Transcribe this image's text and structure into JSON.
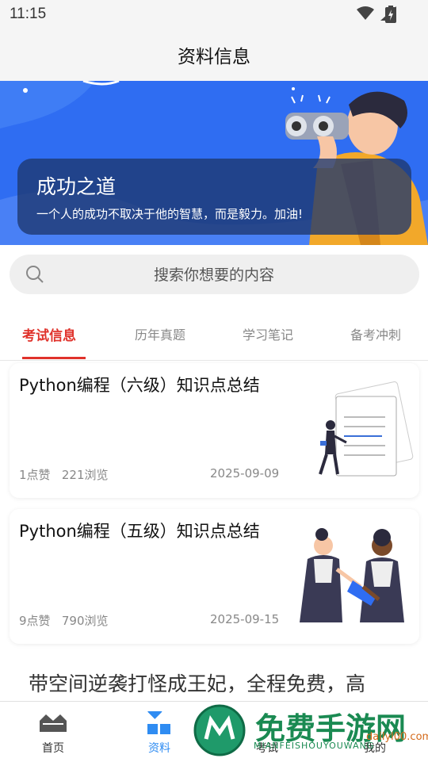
{
  "status": {
    "time": "11:15"
  },
  "header": {
    "title": "资料信息"
  },
  "banner": {
    "title": "成功之道",
    "subtitle": "一个人的成功不取决于他的智慧，而是毅力。加油!"
  },
  "search": {
    "placeholder": "搜索你想要的内容"
  },
  "tabs": [
    {
      "label": "考试信息",
      "active": true
    },
    {
      "label": "历年真题"
    },
    {
      "label": "学习笔记"
    },
    {
      "label": "备考冲刺"
    }
  ],
  "articles": [
    {
      "title": "Python编程（六级）知识点总结",
      "likes": "1点赞",
      "views": "221浏览",
      "date": "2025-09-09"
    },
    {
      "title": "Python编程（五级）知识点总结",
      "likes": "9点赞",
      "views": "790浏览",
      "date": "2025-09-15"
    }
  ],
  "promo": {
    "text": "带空间逆袭打怪成王妃，全程免费，高"
  },
  "nav": [
    {
      "label": "首页"
    },
    {
      "label": "资料",
      "active": true
    },
    {
      "label": "考试"
    },
    {
      "label": "我的"
    }
  ],
  "watermark": {
    "main": "免费手游网",
    "sub": "MIANFEISHOUYOUWANG",
    "url": "dailyl00.com"
  },
  "colors": {
    "accent": "#e0322b",
    "nav_active": "#2f8cf2",
    "banner": "#2f6df2"
  }
}
